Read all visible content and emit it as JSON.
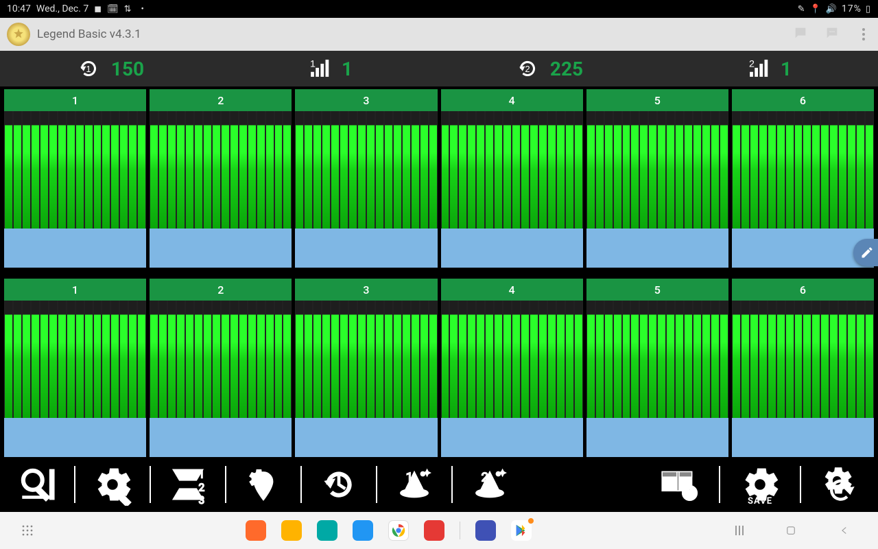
{
  "status": {
    "time": "10:47",
    "date": "Wed., Dec. 7",
    "left_glyphs": [
      "⬢",
      "🗓",
      "✉",
      "⇵"
    ],
    "right_glyphs": [
      "✎",
      "📍",
      "🔊"
    ],
    "battery_text": "17%",
    "battery_icon": "▯"
  },
  "app_bar": {
    "title": "Legend Basic v4.3.1",
    "actions": [
      "notes-icon",
      "chat-icon",
      "overflow-icon"
    ]
  },
  "metrics": {
    "history1_label": "1",
    "history1_value": "150",
    "signal1_label": "1",
    "signal1_value": "1",
    "history2_label": "2",
    "history2_value": "225",
    "signal2_label": "2",
    "signal2_value": "1"
  },
  "rows": [
    {
      "cells": [
        "1",
        "2",
        "3",
        "4",
        "5",
        "6"
      ]
    },
    {
      "cells": [
        "1",
        "2",
        "3",
        "4",
        "5",
        "6"
      ]
    }
  ],
  "bars_per_cell": 16,
  "chart_data": {
    "type": "bar",
    "note": "Two rows × six channels of per-row signal meters. All bars render at equal height (~88% of black band) with no numeric axis shown.",
    "rows": 2,
    "channels_per_row": 6,
    "bars_per_channel": 16,
    "bar_fill_pct_uniform": 88,
    "headers_row1": [
      "1",
      "2",
      "3",
      "4",
      "5",
      "6"
    ],
    "headers_row2": [
      "1",
      "2",
      "3",
      "4",
      "5",
      "6"
    ]
  },
  "toolbar": {
    "left": [
      {
        "name": "search-zoom-icon"
      },
      {
        "name": "settings-tool-icon"
      },
      {
        "name": "rows-split-icon"
      },
      {
        "name": "location-gear-icon"
      },
      {
        "name": "history-icon"
      },
      {
        "name": "wizard-1-icon",
        "badge": "1"
      },
      {
        "name": "wizard-2-icon",
        "badge": "2"
      }
    ],
    "right": [
      {
        "name": "info-card-icon"
      },
      {
        "name": "save-gear-icon",
        "sublabel": "SAVE"
      },
      {
        "name": "settings-sync-icon"
      }
    ]
  },
  "dock": {
    "apps": [
      {
        "name": "app-1",
        "color": "c-orange"
      },
      {
        "name": "app-2",
        "color": "c-yellow"
      },
      {
        "name": "app-3",
        "color": "c-teal"
      },
      {
        "name": "app-4",
        "color": "c-blue"
      },
      {
        "name": "chrome",
        "color": "c-chrome"
      },
      {
        "name": "app-6",
        "color": "c-red"
      },
      {
        "name": "app-7",
        "color": "c-indigo"
      },
      {
        "name": "play-store",
        "color": "c-white",
        "badge": true
      }
    ]
  }
}
